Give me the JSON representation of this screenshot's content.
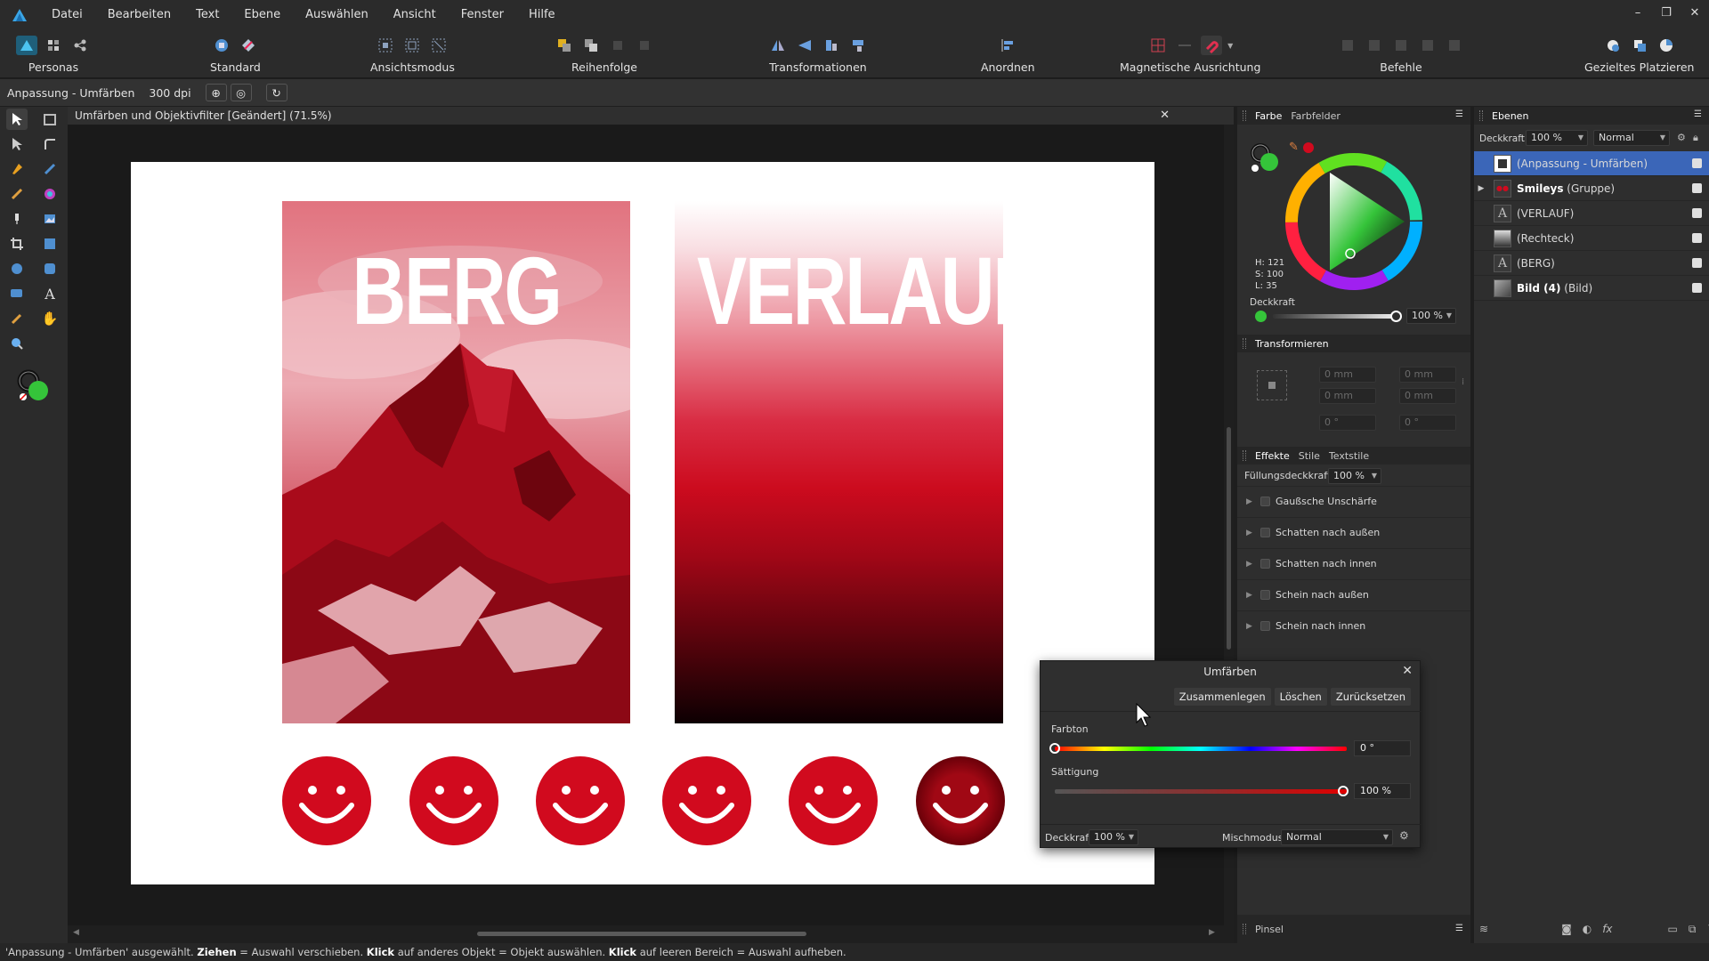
{
  "app": {
    "menu": [
      "Datei",
      "Bearbeiten",
      "Text",
      "Ebene",
      "Auswählen",
      "Ansicht",
      "Fenster",
      "Hilfe"
    ],
    "window_controls": [
      "–",
      "❐",
      "✕"
    ]
  },
  "toolbar": {
    "personas": "Personas",
    "standard": "Standard",
    "ansichtsmodus": "Ansichtsmodus",
    "reihenfolge": "Reihenfolge",
    "transformationen": "Transformationen",
    "anordnen": "Anordnen",
    "magnetische": "Magnetische Ausrichtung",
    "befehle": "Befehle",
    "gezieltes": "Gezieltes Platzieren"
  },
  "contextbar": {
    "layer_name": "Anpassung - Umfärben",
    "dpi": "300 dpi"
  },
  "document": {
    "tab_title": "Umfärben und Objektivfilter [Geändert] (71.5%)",
    "close": "✕",
    "berg_text": "BERG",
    "verlauf_text": "VERLAUF"
  },
  "colors": {
    "accent_red": "#d10a1e",
    "selection_blue": "#3b66b8",
    "fill_green": "#35c43a"
  },
  "color_panel": {
    "tabs": [
      "Farbe",
      "Farbfelder"
    ],
    "h": "H: 121",
    "s": "S: 100",
    "l": "L: 35",
    "opacity_label": "Deckkraft",
    "opacity_value": "100 %"
  },
  "transform_panel": {
    "title": "Transformieren",
    "x": "0 mm",
    "y": "0 mm",
    "w": "0 mm",
    "h": "0 mm",
    "r": "0 °",
    "s": "0 °"
  },
  "effects_panel": {
    "tabs": [
      "Effekte",
      "Stile",
      "Textstile"
    ],
    "fill_opacity_label": "Füllungsdeckkraft:",
    "fill_opacity_value": "100 %",
    "effects": [
      "Gaußsche Unschärfe",
      "Schatten nach außen",
      "Schatten nach innen",
      "Schein nach außen",
      "Schein nach innen"
    ]
  },
  "brush_panel": {
    "title": "Pinsel"
  },
  "layers_panel": {
    "title": "Ebenen",
    "opacity_label": "Deckkraft:",
    "opacity_value": "100 %",
    "blend_mode": "Normal",
    "layers": [
      {
        "name": "(Anpassung - Umfärben)",
        "bold": "",
        "selected": true
      },
      {
        "name": " (Gruppe)",
        "bold": "Smileys",
        "selected": false
      },
      {
        "name": "(VERLAUF)",
        "bold": "",
        "selected": false
      },
      {
        "name": "(Rechteck)",
        "bold": "",
        "selected": false
      },
      {
        "name": "(BERG)",
        "bold": "",
        "selected": false
      },
      {
        "name": " (Bild)",
        "bold": "Bild (4)",
        "selected": false
      }
    ]
  },
  "recolor_dialog": {
    "title": "Umfärben",
    "merge": "Zusammenlegen",
    "delete": "Löschen",
    "reset": "Zurücksetzen",
    "hue_label": "Farbton",
    "hue_value": "0 °",
    "hue_level": 0,
    "sat_label": "Sättigung",
    "sat_value": "100 %",
    "sat_level": 100,
    "opacity_label": "Deckkraft:",
    "opacity_value": "100 %",
    "blend_label": "Mischmodus:",
    "blend_value": "Normal"
  },
  "status": {
    "part1": "'Anpassung - Umfärben' ausgewählt. ",
    "drag": "Ziehen",
    "part2": " = Auswahl verschieben. ",
    "click": "Klick",
    "part3": " auf anderes Objekt = Objekt auswählen. ",
    "click2": "Klick",
    "part4": " auf leeren Bereich = Auswahl aufheben."
  }
}
